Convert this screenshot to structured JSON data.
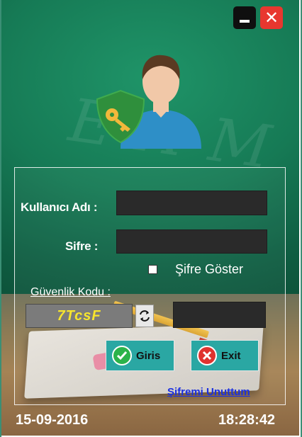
{
  "window": {
    "minimize_icon": "minimize-icon",
    "close_icon": "close-icon"
  },
  "form": {
    "username_label": "Kullanıcı Adı :",
    "username_value": "",
    "password_label": "Sifre :",
    "password_value": "",
    "show_password_label": "Şifre Göster",
    "show_password_checked": false,
    "security_code_label": "Güvenlik Kodu :",
    "captcha_text": "7TcsF",
    "captcha_input_value": "",
    "login_label": "Giris",
    "exit_label": "Exit",
    "forgot_label": "Şifremi Unuttum"
  },
  "status": {
    "date": "15-09-2016",
    "time": "18:28:42"
  },
  "colors": {
    "background": "#167a55",
    "button": "#2aa7a3",
    "close": "#e8372f",
    "captcha_text": "#f7e52d",
    "link": "#1a2fe0"
  }
}
